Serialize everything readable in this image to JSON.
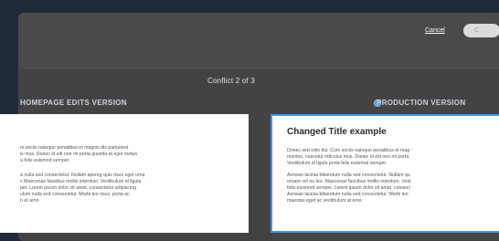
{
  "modal": {
    "cancel_label": "Cancel",
    "confirm_label": "C",
    "counter_text": "Conflict 2 of 3"
  },
  "columns": {
    "left": {
      "heading": "HOMEPAGE EDITS VERSION",
      "paragraph1": "m sociis natoque penatibus et magnis dis parturient\nis mus. Donec id elit non mi porta gravida at eget metus.\na felis euismod semper.",
      "paragraph2": "a nulla sed consectetur. Nullam apereg quis risus eget urna\nc Maecenas faucibus mollis interdum. Vestibulum id ligula\nper. Lorem ipsum dolor sit amet, consectetur adipiscing\nulum nulla sed consectetur. Morbi leo risus, porta ac\nn et arnn"
    },
    "right": {
      "heading": "PRODUCTION VERSION",
      "selected": true,
      "title": "Changed Title example",
      "paragraph1": "Donec sed odio dui. Cum sociis natoque penatibus et mag\nmontes, nascetur ridiculus mus. Donec id elit non mi porta\nVestibulum id ligula porta felis euismod semper.",
      "paragraph2": "Aenean lacinia bibendum nulla sed consectetur. Nullam qu\nornare vel eu leo. Maecenas faucibus mollis interdum. Vest\nfelis euismod semper. Lorem ipsum dolor sit amet, consect\nAenean lacinia bibendum nulla sed consectetur. Morbi leo\nmaestas eget ac vestibulum at eros"
    }
  },
  "colors": {
    "page_background": "#1f2a3a",
    "modal_background": "#474747",
    "selected_border": "#4a90e2"
  }
}
